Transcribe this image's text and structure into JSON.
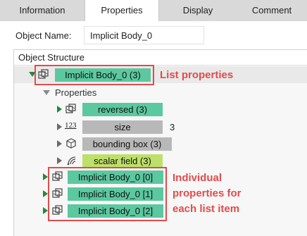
{
  "tabs": [
    {
      "label": "Information",
      "active": false
    },
    {
      "label": "Properties",
      "active": true
    },
    {
      "label": "Display",
      "active": false
    },
    {
      "label": "Comment",
      "active": false
    }
  ],
  "object_name": {
    "label": "Object Name:",
    "value": "Implicit Body_0"
  },
  "structure": {
    "title": "Object Structure",
    "root": "Implicit Body_0 (3)",
    "properties_label": "Properties",
    "props": [
      {
        "label": "reversed (3)"
      },
      {
        "label": "size",
        "value": "3"
      },
      {
        "label": "bounding box (3)"
      },
      {
        "label": "scalar field (3)"
      }
    ],
    "items": [
      "Implicit Body_0 [0]",
      "Implicit Body_0 [1]",
      "Implicit Body_0 [2]"
    ]
  },
  "annotations": {
    "list": "List properties",
    "individual": [
      "Individual",
      "properties for",
      "each list item"
    ]
  },
  "colors": {
    "green_pill": "#5bc8a0",
    "grey_pill": "#b8b8b8",
    "lime_pill": "#bde06a",
    "annotation": "#e24b4b",
    "expand_arrow": "#1f8a3c"
  }
}
